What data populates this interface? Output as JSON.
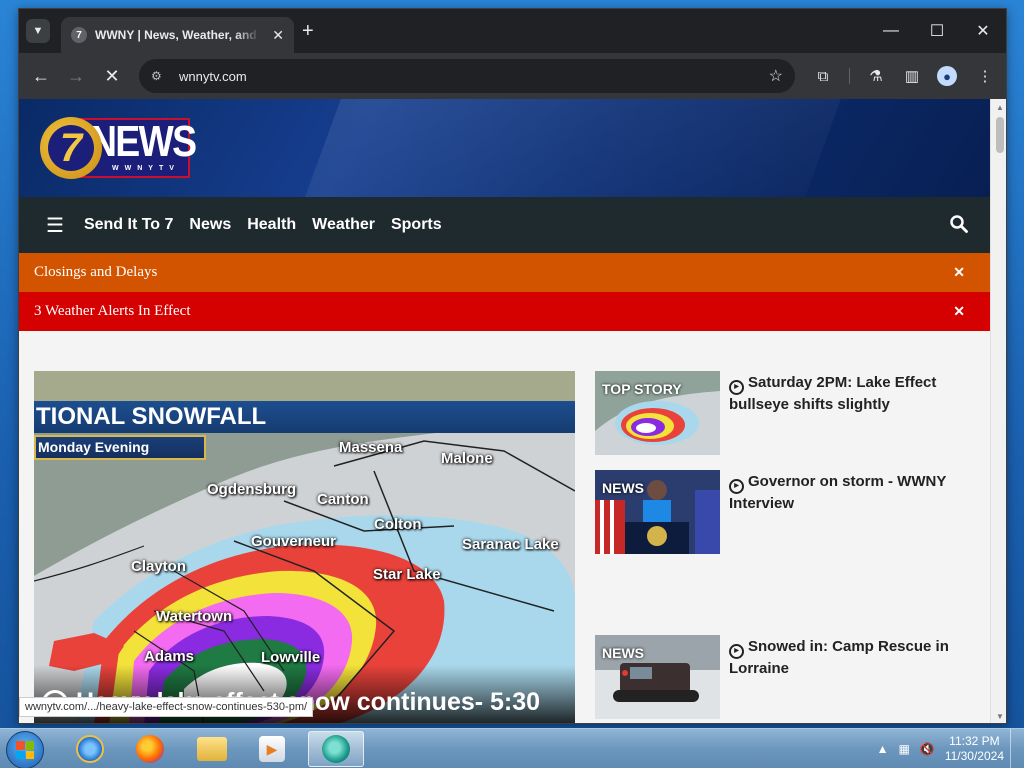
{
  "browser": {
    "tab_title": "WWNY | News, Weather, and Sports",
    "tab_favicon": "7",
    "url": "wnnytv.com",
    "status_url": "wwnytv.com/.../heavy-lake-effect-snow-continues-530-pm/"
  },
  "site": {
    "logo_text": "NEWS",
    "logo_sub": "WWNYTV",
    "logo_number": "7",
    "nav": [
      "Send It To 7",
      "News",
      "Health",
      "Weather",
      "Sports"
    ],
    "alerts": {
      "closings": "Closings and Delays",
      "weather": "3 Weather Alerts In Effect"
    }
  },
  "hero": {
    "band": "TIONAL SNOWFALL",
    "sub": "Monday Evening",
    "caption": "Heavy lake effect snow continues- 5:30",
    "cities": {
      "massena": "Massena",
      "malone": "Malone",
      "ogdensburg": "Ogdensburg",
      "canton": "Canton",
      "colton": "Colton",
      "gouverneur": "Gouverneur",
      "saranac": "Saranac Lake",
      "clayton": "Clayton",
      "starlake": "Star Lake",
      "watertown": "Watertown",
      "adams": "Adams",
      "lowville": "Lowville"
    }
  },
  "stories": [
    {
      "badge": "TOP STORY",
      "title": "Saturday 2PM: Lake Effect bullseye shifts slightly"
    },
    {
      "badge": "NEWS",
      "title": "Governor on storm - WWNY Interview"
    },
    {
      "badge": "NEWS",
      "title": "Snowed in: Camp Rescue in Lorraine"
    }
  ],
  "taskbar": {
    "time": "11:32 PM",
    "date": "11/30/2024"
  },
  "colors": {
    "closings_bar": "#d35400",
    "weather_bar": "#d50000",
    "nav_bar": "#1f2a2e",
    "header": "#163e8f"
  }
}
